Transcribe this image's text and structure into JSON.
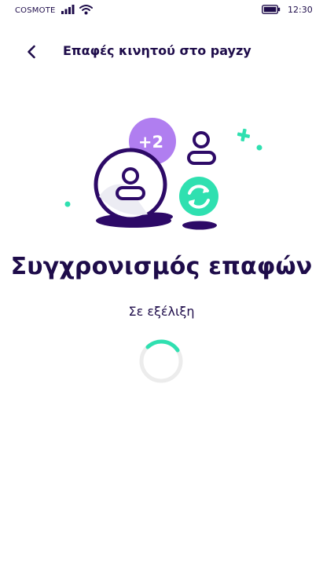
{
  "status_bar": {
    "carrier": "COSMOTE",
    "time": "12:30",
    "icons": [
      "signal-bars-icon",
      "wifi-icon",
      "battery-icon"
    ]
  },
  "header": {
    "back_icon": "chevron-left-icon",
    "title": "Επαφές κινητού στο payzy"
  },
  "illustration": {
    "badge_count": "+2",
    "icons": [
      "contact-large-icon",
      "contact-small-icon",
      "sync-icon",
      "plus-icon"
    ]
  },
  "content": {
    "heading": "Συγχρονισμός επαφών",
    "status": "Σε εξέλιξη"
  },
  "colors": {
    "primary": "#2d0a67",
    "text": "#1e0c4a",
    "accent_green": "#2fe0b0",
    "accent_purple": "#b07ef0",
    "spinner_track": "#ececec"
  }
}
